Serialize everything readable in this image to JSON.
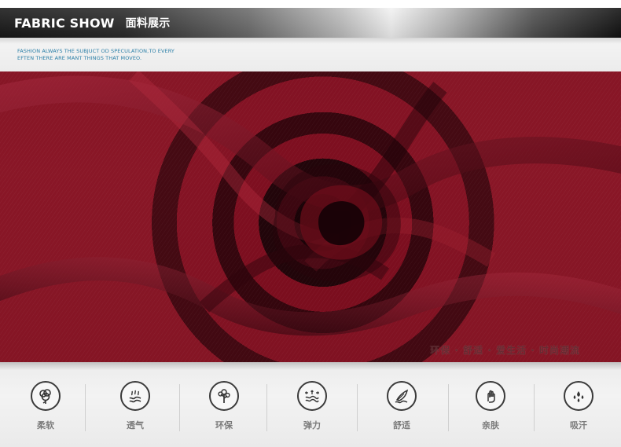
{
  "header": {
    "title_en": "FABRIC SHOW",
    "title_cn": "面料展示"
  },
  "tagline": {
    "line1": "FASHION ALWAYS THE  SUBJUCT OD SPECULATION,TO EVERY",
    "line2": "EFTEN THERE ARE MANT THINGS THAT MOVEO."
  },
  "fabric": {
    "caption": "环保 · 舒适 · 爱生活 · 时尚潮流"
  },
  "features": [
    {
      "label": "柔软",
      "icon": "cotton-icon"
    },
    {
      "label": "透气",
      "icon": "breathable-icon"
    },
    {
      "label": "环保",
      "icon": "eco-tree-icon"
    },
    {
      "label": "弹力",
      "icon": "elastic-icon"
    },
    {
      "label": "舒适",
      "icon": "feather-icon"
    },
    {
      "label": "亲肤",
      "icon": "skin-friendly-icon"
    },
    {
      "label": "吸汗",
      "icon": "sweat-absorb-icon"
    }
  ]
}
